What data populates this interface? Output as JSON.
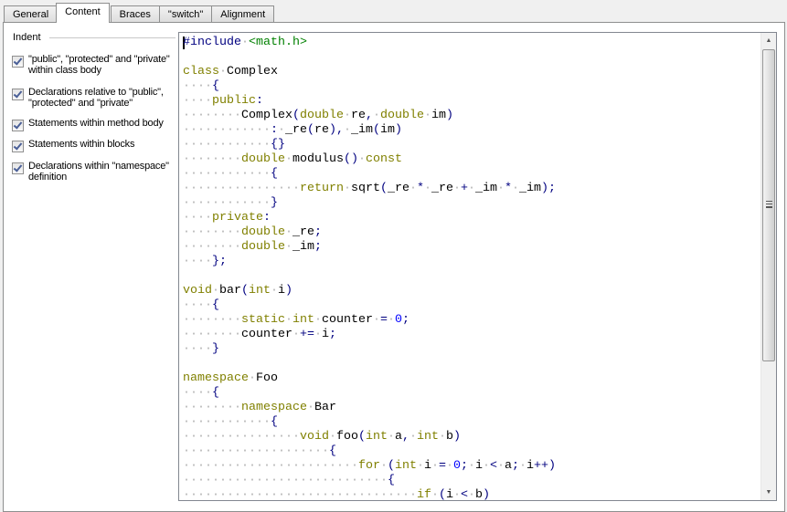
{
  "tabs": [
    {
      "label": "General"
    },
    {
      "label": "Content",
      "active": true
    },
    {
      "label": "Braces"
    },
    {
      "label": "\"switch\""
    },
    {
      "label": "Alignment"
    }
  ],
  "indent": {
    "group_label": "Indent",
    "options": [
      {
        "label": "\"public\", \"protected\" and \"private\" within class body",
        "checked": true
      },
      {
        "label": "Declarations relative to \"public\", \"protected\" and \"private\"",
        "checked": true
      },
      {
        "label": "Statements within method body",
        "checked": true
      },
      {
        "label": "Statements within blocks",
        "checked": true
      },
      {
        "label": "Declarations within \"namespace\" definition",
        "checked": true
      }
    ]
  },
  "colors": {
    "keyword": "#808000",
    "preprocessor": "#000080",
    "string": "#008000",
    "number": "#0000ff",
    "whitespace": "#b0b0b0"
  },
  "preview": {
    "lines": [
      [
        [
          "pp",
          "#include"
        ],
        [
          "w",
          " "
        ],
        [
          "s",
          "<math.h>"
        ]
      ],
      [],
      [
        [
          "k",
          "class"
        ],
        [
          "w",
          " "
        ],
        [
          "i",
          "Complex"
        ]
      ],
      [
        [
          "w",
          "    "
        ],
        [
          "b",
          "{"
        ]
      ],
      [
        [
          "w",
          "    "
        ],
        [
          "k",
          "public"
        ],
        [
          "p",
          ":"
        ]
      ],
      [
        [
          "w",
          "        "
        ],
        [
          "i",
          "Complex"
        ],
        [
          "p",
          "("
        ],
        [
          "k",
          "double"
        ],
        [
          "w",
          " "
        ],
        [
          "i",
          "re"
        ],
        [
          "p",
          ","
        ],
        [
          "w",
          " "
        ],
        [
          "k",
          "double"
        ],
        [
          "w",
          " "
        ],
        [
          "i",
          "im"
        ],
        [
          "p",
          ")"
        ]
      ],
      [
        [
          "w",
          "            "
        ],
        [
          "p",
          ":"
        ],
        [
          "w",
          " "
        ],
        [
          "i",
          "_re"
        ],
        [
          "p",
          "("
        ],
        [
          "i",
          "re"
        ],
        [
          "p",
          "),"
        ],
        [
          "w",
          " "
        ],
        [
          "i",
          "_im"
        ],
        [
          "p",
          "("
        ],
        [
          "i",
          "im"
        ],
        [
          "p",
          ")"
        ]
      ],
      [
        [
          "w",
          "            "
        ],
        [
          "b",
          "{}"
        ]
      ],
      [
        [
          "w",
          "        "
        ],
        [
          "k",
          "double"
        ],
        [
          "w",
          " "
        ],
        [
          "i",
          "modulus"
        ],
        [
          "p",
          "()"
        ],
        [
          "w",
          " "
        ],
        [
          "k",
          "const"
        ]
      ],
      [
        [
          "w",
          "            "
        ],
        [
          "b",
          "{"
        ]
      ],
      [
        [
          "w",
          "                "
        ],
        [
          "k",
          "return"
        ],
        [
          "w",
          " "
        ],
        [
          "i",
          "sqrt"
        ],
        [
          "p",
          "("
        ],
        [
          "i",
          "_re"
        ],
        [
          "w",
          " "
        ],
        [
          "o",
          "*"
        ],
        [
          "w",
          " "
        ],
        [
          "i",
          "_re"
        ],
        [
          "w",
          " "
        ],
        [
          "o",
          "+"
        ],
        [
          "w",
          " "
        ],
        [
          "i",
          "_im"
        ],
        [
          "w",
          " "
        ],
        [
          "o",
          "*"
        ],
        [
          "w",
          " "
        ],
        [
          "i",
          "_im"
        ],
        [
          "p",
          ");"
        ]
      ],
      [
        [
          "w",
          "            "
        ],
        [
          "b",
          "}"
        ]
      ],
      [
        [
          "w",
          "    "
        ],
        [
          "k",
          "private"
        ],
        [
          "p",
          ":"
        ]
      ],
      [
        [
          "w",
          "        "
        ],
        [
          "k",
          "double"
        ],
        [
          "w",
          " "
        ],
        [
          "i",
          "_re"
        ],
        [
          "p",
          ";"
        ]
      ],
      [
        [
          "w",
          "        "
        ],
        [
          "k",
          "double"
        ],
        [
          "w",
          " "
        ],
        [
          "i",
          "_im"
        ],
        [
          "p",
          ";"
        ]
      ],
      [
        [
          "w",
          "    "
        ],
        [
          "b",
          "}"
        ],
        [
          "p",
          ";"
        ]
      ],
      [],
      [
        [
          "k",
          "void"
        ],
        [
          "w",
          " "
        ],
        [
          "i",
          "bar"
        ],
        [
          "p",
          "("
        ],
        [
          "k",
          "int"
        ],
        [
          "w",
          " "
        ],
        [
          "i",
          "i"
        ],
        [
          "p",
          ")"
        ]
      ],
      [
        [
          "w",
          "    "
        ],
        [
          "b",
          "{"
        ]
      ],
      [
        [
          "w",
          "        "
        ],
        [
          "k",
          "static"
        ],
        [
          "w",
          " "
        ],
        [
          "k",
          "int"
        ],
        [
          "w",
          " "
        ],
        [
          "i",
          "counter"
        ],
        [
          "w",
          " "
        ],
        [
          "o",
          "="
        ],
        [
          "w",
          " "
        ],
        [
          "n",
          "0"
        ],
        [
          "p",
          ";"
        ]
      ],
      [
        [
          "w",
          "        "
        ],
        [
          "i",
          "counter"
        ],
        [
          "w",
          " "
        ],
        [
          "o",
          "+="
        ],
        [
          "w",
          " "
        ],
        [
          "i",
          "i"
        ],
        [
          "p",
          ";"
        ]
      ],
      [
        [
          "w",
          "    "
        ],
        [
          "b",
          "}"
        ]
      ],
      [],
      [
        [
          "k",
          "namespace"
        ],
        [
          "w",
          " "
        ],
        [
          "i",
          "Foo"
        ]
      ],
      [
        [
          "w",
          "    "
        ],
        [
          "b",
          "{"
        ]
      ],
      [
        [
          "w",
          "        "
        ],
        [
          "k",
          "namespace"
        ],
        [
          "w",
          " "
        ],
        [
          "i",
          "Bar"
        ]
      ],
      [
        [
          "w",
          "            "
        ],
        [
          "b",
          "{"
        ]
      ],
      [
        [
          "w",
          "                "
        ],
        [
          "k",
          "void"
        ],
        [
          "w",
          " "
        ],
        [
          "i",
          "foo"
        ],
        [
          "p",
          "("
        ],
        [
          "k",
          "int"
        ],
        [
          "w",
          " "
        ],
        [
          "i",
          "a"
        ],
        [
          "p",
          ","
        ],
        [
          "w",
          " "
        ],
        [
          "k",
          "int"
        ],
        [
          "w",
          " "
        ],
        [
          "i",
          "b"
        ],
        [
          "p",
          ")"
        ]
      ],
      [
        [
          "w",
          "                    "
        ],
        [
          "b",
          "{"
        ]
      ],
      [
        [
          "w",
          "                        "
        ],
        [
          "k",
          "for"
        ],
        [
          "w",
          " "
        ],
        [
          "p",
          "("
        ],
        [
          "k",
          "int"
        ],
        [
          "w",
          " "
        ],
        [
          "i",
          "i"
        ],
        [
          "w",
          " "
        ],
        [
          "o",
          "="
        ],
        [
          "w",
          " "
        ],
        [
          "n",
          "0"
        ],
        [
          "p",
          ";"
        ],
        [
          "w",
          " "
        ],
        [
          "i",
          "i"
        ],
        [
          "w",
          " "
        ],
        [
          "o",
          "<"
        ],
        [
          "w",
          " "
        ],
        [
          "i",
          "a"
        ],
        [
          "p",
          ";"
        ],
        [
          "w",
          " "
        ],
        [
          "i",
          "i"
        ],
        [
          "o",
          "++"
        ],
        [
          "p",
          ")"
        ]
      ],
      [
        [
          "w",
          "                            "
        ],
        [
          "b",
          "{"
        ]
      ],
      [
        [
          "w",
          "                                "
        ],
        [
          "k",
          "if"
        ],
        [
          "w",
          " "
        ],
        [
          "p",
          "("
        ],
        [
          "i",
          "i"
        ],
        [
          "w",
          " "
        ],
        [
          "o",
          "<"
        ],
        [
          "w",
          " "
        ],
        [
          "i",
          "b"
        ],
        [
          "p",
          ")"
        ]
      ]
    ]
  },
  "scrollbar": {
    "position_fraction": 0.0,
    "visible_fraction": 0.68
  }
}
